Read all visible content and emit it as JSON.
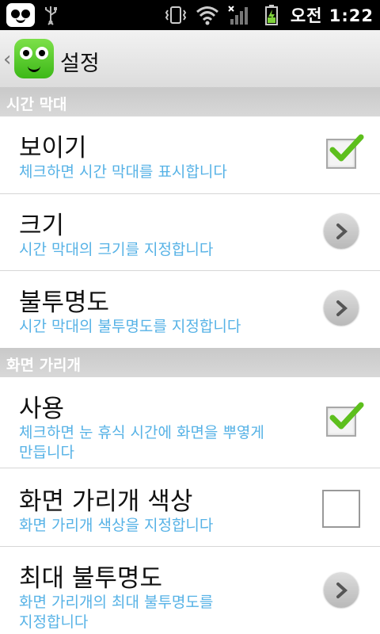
{
  "status_bar": {
    "time": "오전 1:22"
  },
  "title_bar": {
    "title": "설정"
  },
  "sections": [
    {
      "header": "시간 막대",
      "items": [
        {
          "title": "보이기",
          "summary": "체크하면 시간 막대를 표시합니다",
          "control": "checkbox",
          "checked": true
        },
        {
          "title": "크기",
          "summary": "시간 막대의 크기를 지정합니다",
          "control": "arrow"
        },
        {
          "title": "불투명도",
          "summary": "시간 막대의 불투명도를 지정합니다",
          "control": "arrow"
        }
      ]
    },
    {
      "header": "화면 가리개",
      "items": [
        {
          "title": "사용",
          "summary_line1": "체크하면 눈 휴식 시간에 화면을 뿌옇게",
          "summary_line2": "만듭니다",
          "control": "checkbox",
          "checked": true
        },
        {
          "title": "화면 가리개 색상",
          "summary": "화면 가리개 색상을 지정합니다",
          "control": "checkbox",
          "checked": false
        },
        {
          "title": "최대 불투명도",
          "summary_line1": "화면 가리개의 최대 불투명도를",
          "summary_line2": "지정합니다",
          "control": "arrow"
        }
      ]
    }
  ],
  "colors": {
    "summary_text": "#56b2e6",
    "check_mark": "#5dbf1d",
    "section_header_bg": "#cdcdcd"
  }
}
